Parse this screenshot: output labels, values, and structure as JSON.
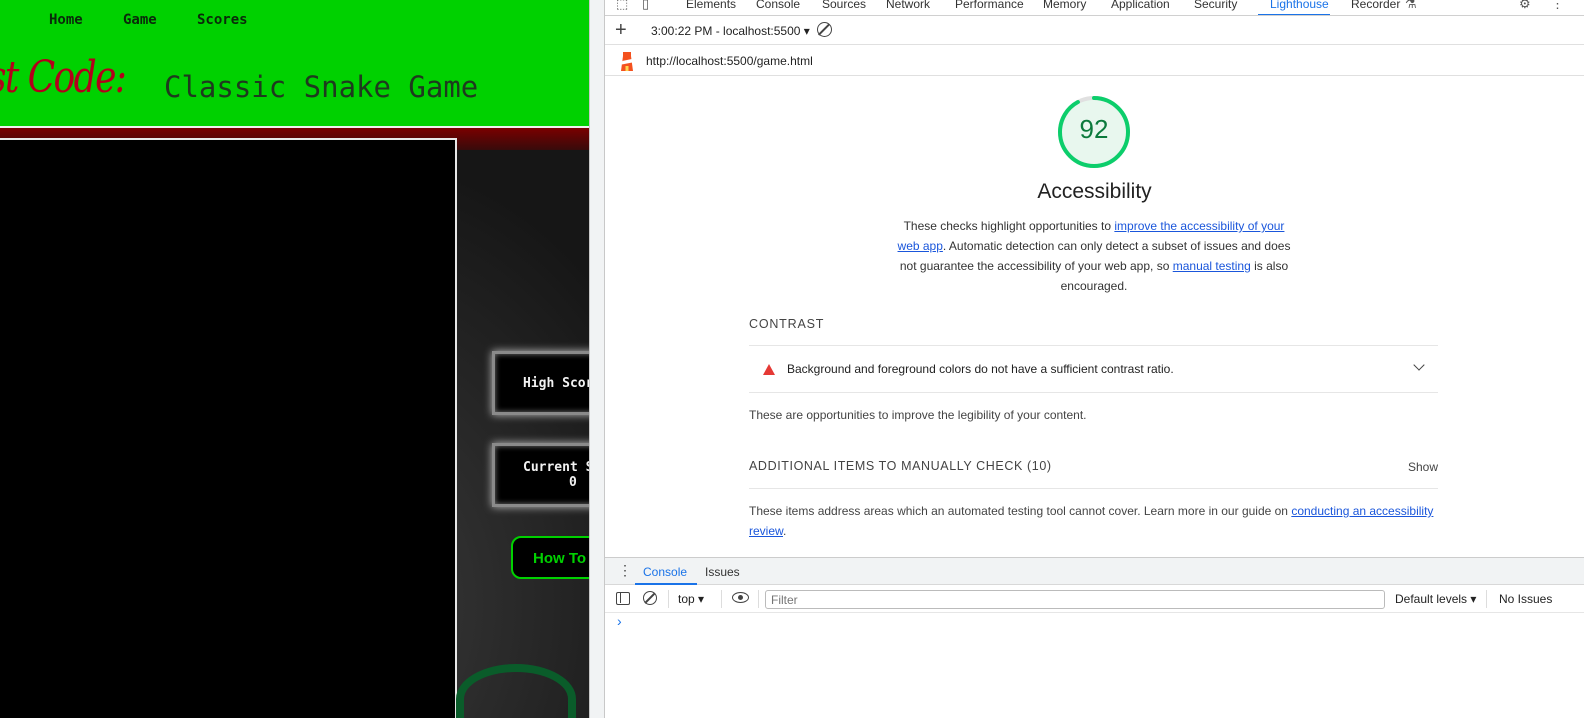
{
  "game_page": {
    "nav": [
      "Home",
      "Game",
      "Scores"
    ],
    "brand": "st Code:",
    "title": "Classic Snake Game",
    "high_score_label": "High Scor",
    "current_score_label": "Current S",
    "current_score_value": "0",
    "how_to_label": "How To"
  },
  "devtools": {
    "tabs": [
      "Elements",
      "Console",
      "Sources",
      "Network",
      "Performance",
      "Memory",
      "Application",
      "Security",
      "Lighthouse",
      "Recorder"
    ],
    "active_tab": "Lighthouse",
    "toolbar": {
      "report_label": "3:00:22 PM - localhost:5500 ▾"
    },
    "url": "http://localhost:5500/game.html",
    "report": {
      "score": "92",
      "score_fraction": 0.92,
      "score_color": "#0cce6b",
      "category": "Accessibility",
      "desc_1": "These checks highlight opportunities to ",
      "link_1": "improve the accessibility of your web app",
      "desc_2": ". Automatic detection can only detect a subset of issues and does not guarantee the accessibility of your web app, so ",
      "link_2": "manual testing",
      "desc_3": " is also encouraged.",
      "contrast_heading": "CONTRAST",
      "audit_text": "Background and foreground colors do not have a sufficient contrast ratio.",
      "opportunities_text": "These are opportunities to improve the legibility of your content.",
      "manual_heading": "ADDITIONAL ITEMS TO MANUALLY CHECK (10)",
      "show_label": "Show",
      "manual_desc": "These items address areas which an automated testing tool cannot cover. Learn more in our guide on ",
      "manual_link": "conducting an accessibility review",
      "manual_end": "."
    },
    "drawer": {
      "tabs": [
        "Console",
        "Issues"
      ],
      "context": "top ▾",
      "filter_placeholder": "Filter",
      "levels": "Default levels ▾",
      "issues": "No Issues",
      "prompt": "›"
    }
  }
}
